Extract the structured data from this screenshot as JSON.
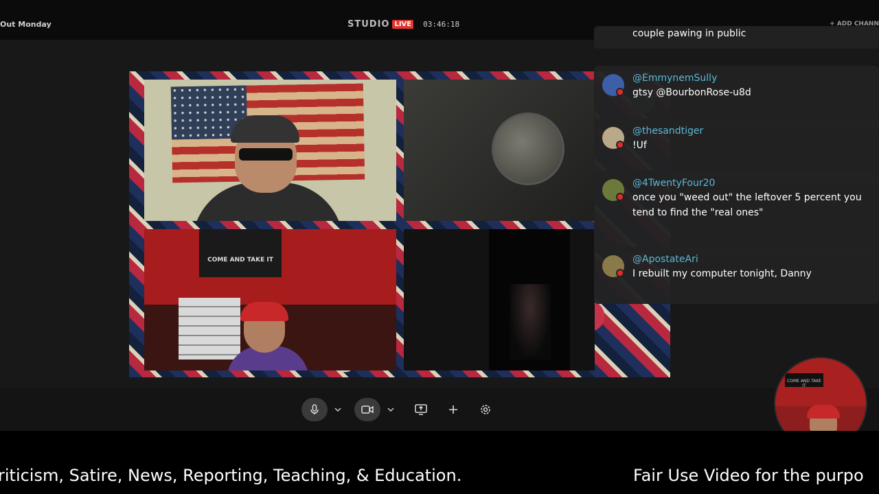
{
  "topbar": {
    "show_title": "Out Monday",
    "studio_label": "STUDIO",
    "live_badge": "LIVE",
    "timer": "03:46:18",
    "add_channel": "+ ADD CHANN"
  },
  "chat": {
    "messages": [
      {
        "user": "",
        "text": "couple pawing in public",
        "avatar_color": "#444444"
      },
      {
        "user": "@EmmynemSully",
        "text": "gtsy @BourbonRose-u8d",
        "avatar_color": "#3d5fa8"
      },
      {
        "user": "@thesandtiger",
        "text": "!Uf",
        "avatar_color": "#b9a98a"
      },
      {
        "user": "@4TwentyFour20",
        "text": "once you \"weed out\" the leftover 5 percent you tend to find the \"real ones\"",
        "avatar_color": "#6b7a3a"
      },
      {
        "user": "@ApostateAri",
        "text": "I rebuilt my computer tonight, Danny",
        "avatar_color": "#8a7a4a"
      }
    ]
  },
  "tiles": {
    "banner_text": "COME AND TAKE IT",
    "pip_banner_text": "COME AND TAKE IT"
  },
  "controls": {
    "icons": [
      "microphone-icon",
      "chevron-down-icon",
      "camera-icon",
      "chevron-down-icon",
      "screen-share-icon",
      "plus-icon",
      "gear-icon"
    ]
  },
  "ticker": {
    "segment_1": "riticism, Satire, News, Reporting, Teaching, & Education.",
    "segment_2": "Fair Use Video for the purpo"
  },
  "colors": {
    "live": "#e2332d",
    "username": "#5ab9d8",
    "youtube": "#e12b2b"
  }
}
